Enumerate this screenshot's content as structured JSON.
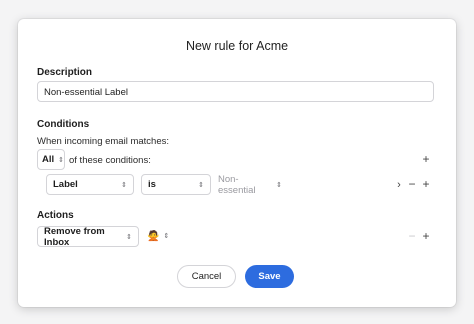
{
  "dialog": {
    "title": "New rule for Acme",
    "description": {
      "label": "Description",
      "value": "Non-essential Label"
    },
    "conditions": {
      "label": "Conditions",
      "intro": "When incoming email matches:",
      "match_mode": "All",
      "match_suffix": "of these conditions:",
      "rows": [
        {
          "field": "Label",
          "operator": "is",
          "value": "Non-essential"
        }
      ]
    },
    "actions": {
      "label": "Actions",
      "rows": [
        {
          "action": "Remove from Inbox",
          "value": "🙅"
        }
      ]
    },
    "buttons": {
      "cancel": "Cancel",
      "save": "Save"
    }
  },
  "icons": {
    "add": "plus-icon",
    "remove": "minus-icon",
    "expand": "chevron-right-icon",
    "select": "updown-chevron-icon"
  },
  "colors": {
    "accent": "#2d6cdf",
    "border": "#d4d4d8",
    "placeholder": "#9a9aa0"
  }
}
